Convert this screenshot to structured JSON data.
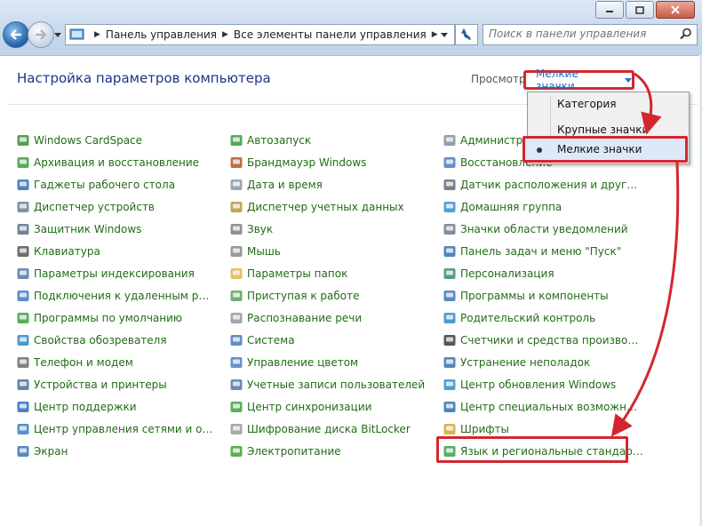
{
  "window": {
    "buttons": [
      "minimize",
      "maximize",
      "close"
    ]
  },
  "address": {
    "crumbs": [
      "Панель управления",
      "Все элементы панели управления"
    ]
  },
  "search": {
    "placeholder": "Поиск в панели управления"
  },
  "header": {
    "title": "Настройка параметров компьютера",
    "view_label": "Просмотр:",
    "view_value": "Мелкие значки"
  },
  "menu": {
    "items": [
      "Категория",
      "Крупные значки",
      "Мелкие значки"
    ],
    "selected": "Мелкие значки"
  },
  "columns": [
    [
      {
        "label": "Windows CardSpace",
        "icon": "cardspace-icon"
      },
      {
        "label": "Архивация и восстановление",
        "icon": "backup-icon"
      },
      {
        "label": "Гаджеты рабочего стола",
        "icon": "gadgets-icon"
      },
      {
        "label": "Диспетчер устройств",
        "icon": "device-manager-icon"
      },
      {
        "label": "Защитник Windows",
        "icon": "defender-icon"
      },
      {
        "label": "Клавиатура",
        "icon": "keyboard-icon"
      },
      {
        "label": "Параметры индексирования",
        "icon": "indexing-icon"
      },
      {
        "label": "Подключения к удаленным рабоч...",
        "icon": "remote-icon"
      },
      {
        "label": "Программы по умолчанию",
        "icon": "default-programs-icon"
      },
      {
        "label": "Свойства обозревателя",
        "icon": "internet-options-icon"
      },
      {
        "label": "Телефон и модем",
        "icon": "phone-modem-icon"
      },
      {
        "label": "Устройства и принтеры",
        "icon": "printers-icon"
      },
      {
        "label": "Центр поддержки",
        "icon": "action-center-flag-icon"
      },
      {
        "label": "Центр управления сетями и общи...",
        "icon": "network-icon"
      },
      {
        "label": "Экран",
        "icon": "display-icon"
      }
    ],
    [
      {
        "label": "Автозапуск",
        "icon": "autoplay-icon"
      },
      {
        "label": "Брандмауэр Windows",
        "icon": "firewall-icon"
      },
      {
        "label": "Дата и время",
        "icon": "datetime-icon"
      },
      {
        "label": "Диспетчер учетных данных",
        "icon": "credential-icon"
      },
      {
        "label": "Звук",
        "icon": "sound-icon"
      },
      {
        "label": "Мышь",
        "icon": "mouse-icon"
      },
      {
        "label": "Параметры папок",
        "icon": "folder-options-icon"
      },
      {
        "label": "Приступая к работе",
        "icon": "getting-started-icon"
      },
      {
        "label": "Распознавание речи",
        "icon": "speech-icon"
      },
      {
        "label": "Система",
        "icon": "system-icon"
      },
      {
        "label": "Управление цветом",
        "icon": "color-icon"
      },
      {
        "label": "Учетные записи пользователей",
        "icon": "users-icon"
      },
      {
        "label": "Центр синхронизации",
        "icon": "sync-icon"
      },
      {
        "label": "Шифрование диска BitLocker",
        "icon": "bitlocker-icon"
      },
      {
        "label": "Электропитание",
        "icon": "power-icon"
      }
    ],
    [
      {
        "label": "Администрирование",
        "icon": "admin-tools-icon"
      },
      {
        "label": "Восстановление",
        "icon": "recovery-icon"
      },
      {
        "label": "Датчик расположения и другие дат...",
        "icon": "sensor-icon"
      },
      {
        "label": "Домашняя группа",
        "icon": "homegroup-icon"
      },
      {
        "label": "Значки области уведомлений",
        "icon": "notification-icon"
      },
      {
        "label": "Панель задач и меню \"Пуск\"",
        "icon": "taskbar-icon"
      },
      {
        "label": "Персонализация",
        "icon": "personalization-icon"
      },
      {
        "label": "Программы и компоненты",
        "icon": "programs-icon"
      },
      {
        "label": "Родительский контроль",
        "icon": "parental-icon"
      },
      {
        "label": "Счетчики и средства производител...",
        "icon": "performance-icon"
      },
      {
        "label": "Устранение неполадок",
        "icon": "troubleshoot-icon"
      },
      {
        "label": "Центр обновления Windows",
        "icon": "update-icon"
      },
      {
        "label": "Центр специальных возможностей",
        "icon": "accessibility-icon"
      },
      {
        "label": "Шрифты",
        "icon": "fonts-icon"
      },
      {
        "label": "Язык и региональные стандарты",
        "icon": "region-language-icon"
      }
    ]
  ],
  "colors": {
    "link": "#226c17",
    "heading": "#1e3287",
    "annotation": "#d4262f",
    "view_link": "#1c6fc2"
  }
}
